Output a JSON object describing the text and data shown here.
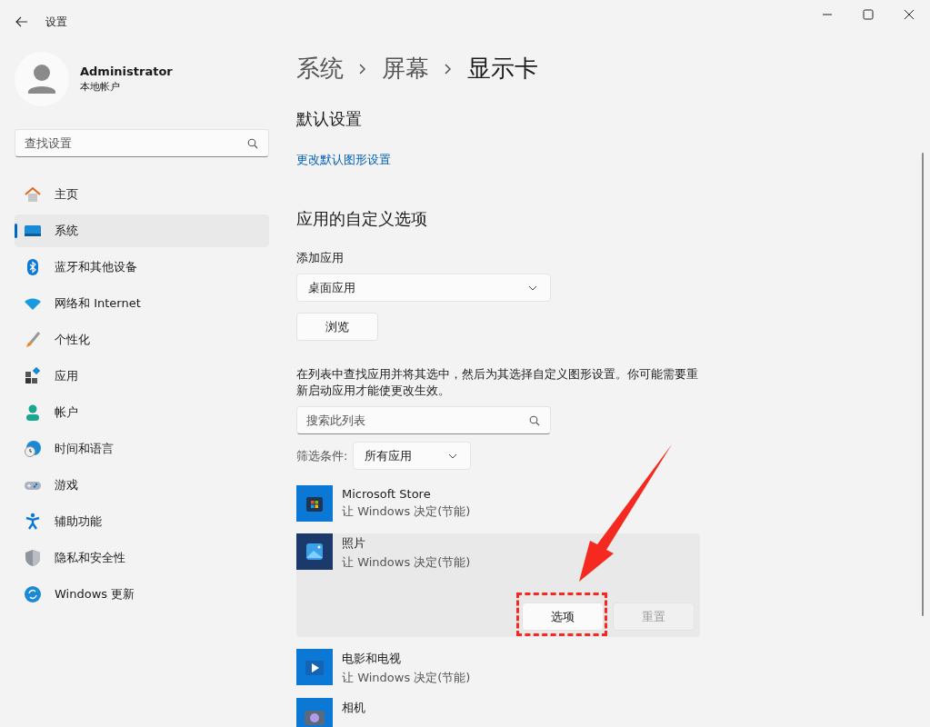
{
  "window": {
    "title": "设置"
  },
  "profile": {
    "name": "Administrator",
    "account": "本地帐户"
  },
  "search": {
    "placeholder": "查找设置"
  },
  "sidebar": {
    "items": [
      {
        "label": "主页",
        "selected": false
      },
      {
        "label": "系统",
        "selected": true
      },
      {
        "label": "蓝牙和其他设备",
        "selected": false
      },
      {
        "label": "网络和 Internet",
        "selected": false
      },
      {
        "label": "个性化",
        "selected": false
      },
      {
        "label": "应用",
        "selected": false
      },
      {
        "label": "帐户",
        "selected": false
      },
      {
        "label": "时间和语言",
        "selected": false
      },
      {
        "label": "游戏",
        "selected": false
      },
      {
        "label": "辅助功能",
        "selected": false
      },
      {
        "label": "隐私和安全性",
        "selected": false
      },
      {
        "label": "Windows 更新",
        "selected": false
      }
    ]
  },
  "breadcrumb": [
    "系统",
    "屏幕",
    "显示卡"
  ],
  "default_section": {
    "heading": "默认设置",
    "link": "更改默认图形设置"
  },
  "custom_section": {
    "heading": "应用的自定义选项",
    "add_label": "添加应用",
    "app_type": "桌面应用",
    "browse": "浏览",
    "hint": "在列表中查找应用并将其选中，然后为其选择自定义图形设置。你可能需要重新启动应用才能使更改生效。",
    "list_search": {
      "placeholder": "搜索此列表"
    },
    "filter_label": "筛选条件:",
    "filter_value": "所有应用"
  },
  "apps": [
    {
      "name": "Microsoft Store",
      "setting": "让 Windows 决定(节能)",
      "kind": "store",
      "expanded": false
    },
    {
      "name": "照片",
      "setting": "让 Windows 决定(节能)",
      "kind": "photos",
      "expanded": true,
      "buttons": [
        {
          "label": "选项",
          "disabled": false
        },
        {
          "label": "重置",
          "disabled": true
        }
      ]
    },
    {
      "name": "电影和电视",
      "setting": "让 Windows 决定(节能)",
      "kind": "movies",
      "expanded": false
    },
    {
      "name": "相机",
      "kind": "camera",
      "expanded": false
    }
  ]
}
